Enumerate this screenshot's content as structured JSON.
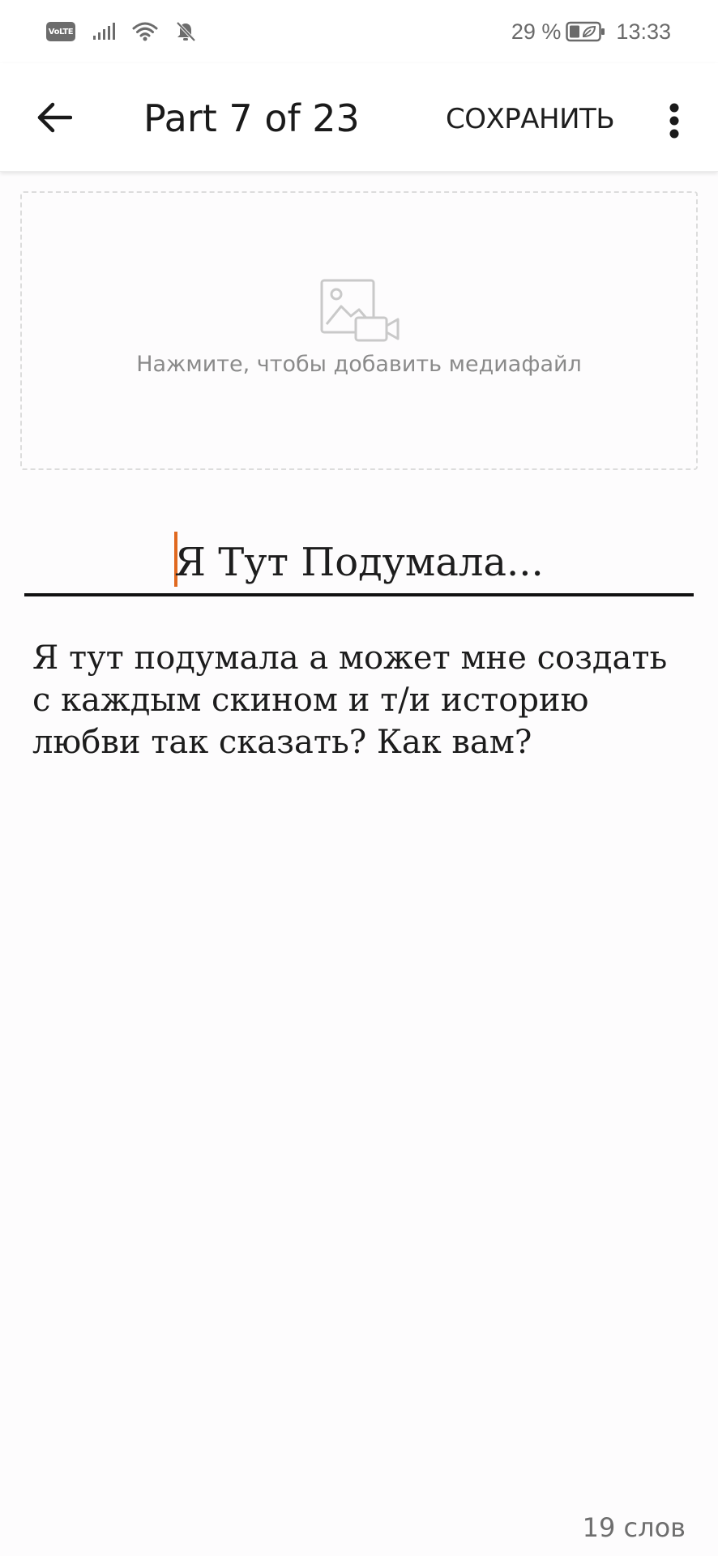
{
  "status_bar": {
    "network_badge": "VoLTE",
    "icons": [
      "signal-icon",
      "wifi-icon",
      "bell-off-icon",
      "battery-icon"
    ],
    "battery_percent": "29 %",
    "time": "13:33"
  },
  "app_bar": {
    "back_icon": "arrow-left-icon",
    "title": "Part 7 of 23",
    "save_label": "СОХРАНИТЬ",
    "more_icon": "more-vertical-icon"
  },
  "media": {
    "icon": "image-video-icon",
    "hint": "Нажмите, чтобы добавить медиафайл"
  },
  "editor": {
    "title_value": "Я Тут Подумала...",
    "body_text": "Я тут подумала а может мне создать с каждым скином и т/и историю любви так сказать? Как вам?",
    "caret_color": "#e0681f"
  },
  "footer": {
    "word_count": "19",
    "word_count_label": "слов"
  },
  "colors": {
    "background": "#fdfcfd",
    "accent": "#e0681f",
    "text": "#1c1c1c",
    "muted": "#8a8a8a"
  }
}
